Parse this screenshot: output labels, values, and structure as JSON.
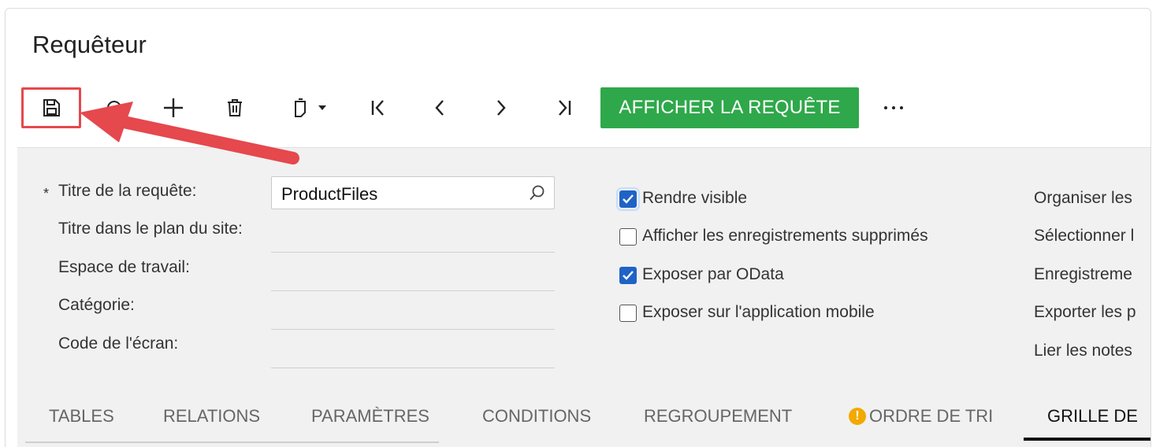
{
  "page": {
    "title": "Requêteur"
  },
  "toolbar": {
    "save_icon": "floppy-disk-icon",
    "undo_icon": "undo-icon",
    "add_icon": "plus-icon",
    "delete_icon": "trash-icon",
    "copy_icon": "copy-paste-icon",
    "first_icon": "first-record-icon",
    "prev_icon": "previous-record-icon",
    "next_icon": "next-record-icon",
    "last_icon": "last-record-icon",
    "primary_label": "AFFICHER LA REQUÊTE",
    "more_icon": "more-options-icon",
    "accent_color": "#2ea84a",
    "highlight_color": "#e5484d"
  },
  "form": {
    "fields": [
      {
        "label": "Titre de la requête:",
        "required": true,
        "value": "ProductFiles"
      },
      {
        "label": "Titre dans le plan du site:",
        "value": ""
      },
      {
        "label": "Espace de travail:",
        "value": ""
      },
      {
        "label": "Catégorie:",
        "value": ""
      },
      {
        "label": "Code de l'écran:",
        "value": ""
      }
    ],
    "checkboxes": [
      {
        "label": "Rendre visible",
        "checked": true
      },
      {
        "label": "Afficher les enregistrements supprimés",
        "checked": false
      },
      {
        "label": "Exposer par OData",
        "checked": true
      },
      {
        "label": "Exposer sur l'application mobile",
        "checked": false
      }
    ],
    "side_links": [
      "Organiser les",
      "Sélectionner l",
      "Enregistreme",
      "Exporter les p",
      "Lier les notes"
    ]
  },
  "tabs": [
    {
      "label": "TABLES"
    },
    {
      "label": "RELATIONS"
    },
    {
      "label": "PARAMÈTRES"
    },
    {
      "label": "CONDITIONS"
    },
    {
      "label": "REGROUPEMENT"
    },
    {
      "label": "ORDRE DE TRI",
      "warning": true
    },
    {
      "label": "GRILLE DE",
      "active": true
    }
  ]
}
